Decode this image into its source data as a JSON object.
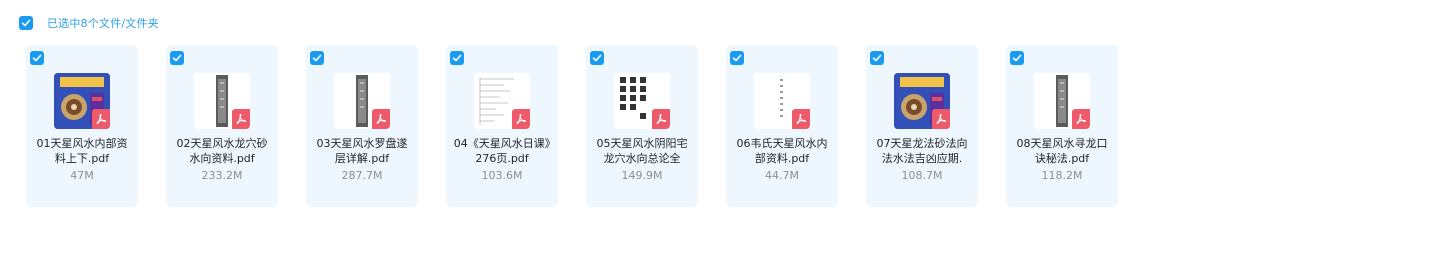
{
  "selection": {
    "label": "已选中8个文件/文件夹",
    "checked": true
  },
  "accent_color": "#1a9bf0",
  "pdf_badge_color": "#ee5a6a",
  "files": [
    {
      "name": "01天星风水内部资料上下.pdf",
      "size": "47M",
      "checked": true,
      "thumb": "blue-cover-icon"
    },
    {
      "name": "02天星风水龙穴砂水向资料.pdf",
      "size": "233.2M",
      "checked": true,
      "thumb": "text-column-icon"
    },
    {
      "name": "03天星风水罗盘遂层详解.pdf",
      "size": "287.7M",
      "checked": true,
      "thumb": "text-column-icon"
    },
    {
      "name": "04《天星风水日课》276页.pdf",
      "size": "103.6M",
      "checked": true,
      "thumb": "table-page-icon"
    },
    {
      "name": "05天星风水阴阳宅龙穴水向总论全",
      "size": "149.9M",
      "checked": true,
      "thumb": "vertical-title-icon"
    },
    {
      "name": "06韦氏天星风水内部资料.pdf",
      "size": "44.7M",
      "checked": true,
      "thumb": "sparse-text-icon"
    },
    {
      "name": "07天星龙法砂法向法水法吉凶应期.",
      "size": "108.7M",
      "checked": true,
      "thumb": "blue-cover-icon"
    },
    {
      "name": "08天星风水寻龙口诀秘法.pdf",
      "size": "118.2M",
      "checked": true,
      "thumb": "text-column-icon"
    }
  ]
}
